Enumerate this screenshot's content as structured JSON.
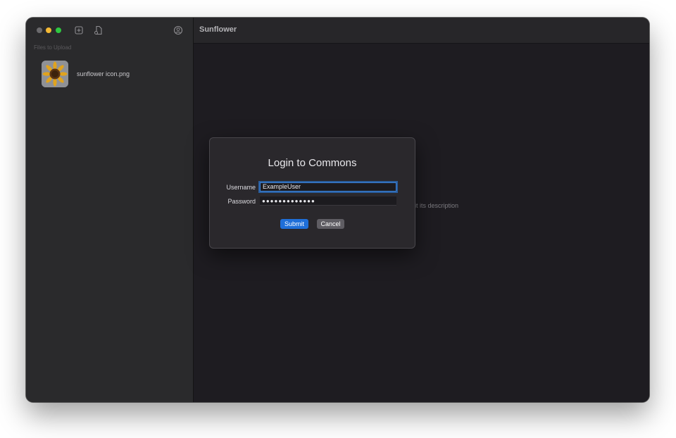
{
  "window": {
    "title": "Sunflower"
  },
  "sidebar": {
    "section_header": "Files to Upload",
    "files": [
      {
        "name": "sunflower icon.png",
        "icon": "sunflower-thumbnail"
      }
    ]
  },
  "toolbar": {
    "icons": [
      "add-file-icon",
      "document-icon",
      "account-icon"
    ]
  },
  "main": {
    "placeholder_fragment": "it its description"
  },
  "dialog": {
    "title": "Login to Commons",
    "username_label": "Username",
    "username_value": "ExampleUser",
    "password_label": "Password",
    "password_value": "●●●●●●●●●●●●●",
    "submit_label": "Submit",
    "cancel_label": "Cancel"
  },
  "colors": {
    "accent": "#1f6fd8",
    "focus_ring": "#3b80d5"
  }
}
